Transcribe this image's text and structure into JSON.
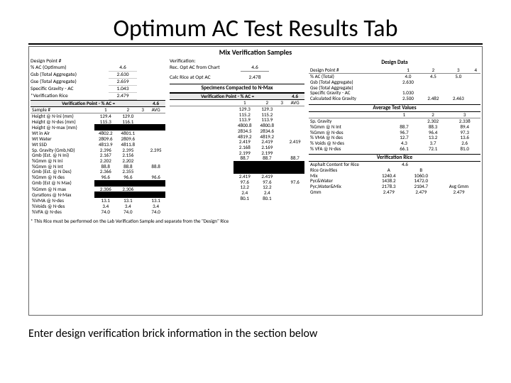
{
  "title": "Optimum AC Test Results Tab",
  "sheet": {
    "heading": "Mix Verification Samples",
    "left": {
      "designPoint": "Design Point #",
      "pctACopt": "% AC (Optimum)",
      "gsbTotal": "Gsb (Total Aggregate)",
      "gseTotal": "Gse (Total Aggregate)",
      "specGravAC": "Specific Gravity - AC",
      "verifRice": "*Verification Rice",
      "vals": {
        "pctAC": "4.6",
        "gsb": "2.630",
        "gse": "2.659",
        "sg": "1.043",
        "rice": "2.479"
      },
      "verifHdr": "Verification Point - % AC =",
      "verifAC": "4.6",
      "sampleHdr": "Sample #",
      "rows": {
        "htNini": "Height @ N-ini (mm)",
        "htNdes": "Height @ N-des (mm)",
        "htNmax": "Height @ N-max (mm)",
        "wtAir": "Wt in Air",
        "wtWater": "Wt Water",
        "wtSSD": "Wt SSD",
        "spGrav": "Sp. Gravity (Gmb,ND)",
        "gmbNini": "Gmb (Est. @ N Ini)",
        "pctGmmNini": "%Gmm @ N Ini",
        "pctGmmNint": "%Gmm @ N Int",
        "gmbNdes": "Gmb (Est. @ N Des)",
        "pctGmmNdes": "%Gmm @ N des",
        "gmbNmax": "Gmb (Est @ N Max)",
        "pctGmmNmax": "%Gmm @ N max",
        "gyrNmax": "Gyrations @ N-Max",
        "pctVMA": "%VMA @ N-des",
        "pctVoids": "%Voids @ N-des",
        "pctVFA": "%VFA @ N-des"
      },
      "data": {
        "htNini": [
          "129.4",
          "129.0",
          "",
          "",
          ""
        ],
        "htNdes": [
          "115.3",
          "116.1",
          "",
          "",
          ""
        ],
        "wtAir": [
          "4802.2",
          "4801.1",
          "",
          "",
          ""
        ],
        "wtWater": [
          "2809.6",
          "2809.6",
          "",
          "",
          ""
        ],
        "wtSSD": [
          "4813.9",
          "4811.8",
          "",
          "",
          ""
        ],
        "spGrav": [
          "2.396",
          "2.395",
          "",
          "",
          "2.395"
        ],
        "gmbNini": [
          "2.167",
          "2.156",
          "",
          "",
          ""
        ],
        "pctGmmNini": [
          "2.202",
          "2.202",
          "",
          "",
          ""
        ],
        "pctGmmNint": [
          "88.8",
          "88.8",
          "",
          "",
          "88.8"
        ],
        "gmbNdes": [
          "2.366",
          "2.355",
          "",
          "",
          ""
        ],
        "pctGmmNdes": [
          "96.6",
          "96.6",
          "",
          "",
          "96.6"
        ],
        "gmbNmax": [
          "2.306",
          "2.306",
          "",
          "",
          ""
        ],
        "pctVMA": [
          "13.1",
          "13.1",
          "",
          "",
          "13.1"
        ],
        "pctVoids": [
          "3.4",
          "3.4",
          "",
          "",
          "3.4"
        ],
        "pctVFA": [
          "74.0",
          "74.0",
          "",
          "",
          "74.0"
        ]
      }
    },
    "mid": {
      "verification": "Verification:",
      "recOptLabel": "Rec. Opt AC from Chart",
      "recOpt": "4.6",
      "calcRiceLbl": "Calc Rice at Opt AC",
      "calcRice": "2.478",
      "specHead": "Specimens Compacted to N-Max",
      "verifHdr": "Verification Point - % AC =",
      "verifAC": "4.6",
      "data": {
        "htNini": [
          "129.3",
          "129.3",
          "",
          "",
          ""
        ],
        "htNdes": [
          "115.2",
          "115.2",
          "",
          "",
          ""
        ],
        "htNmax": [
          "113.9",
          "113.9",
          "",
          "",
          ""
        ],
        "wtAir": [
          "4800.8",
          "4800.8",
          "",
          "",
          ""
        ],
        "wtWater": [
          "2834.5",
          "2834.6",
          "",
          "",
          ""
        ],
        "wtSSD": [
          "4819.2",
          "4819.2",
          "",
          "",
          ""
        ],
        "spGrav": [
          "2.419",
          "2.419",
          "",
          "",
          "2.419"
        ],
        "gmbNini": [
          "2.168",
          "2.169",
          "",
          "",
          ""
        ],
        "pctGmmNini": [
          "2.199",
          "2.199",
          "",
          "",
          ""
        ],
        "pctGmmNint": [
          "88.7",
          "88.7",
          "",
          "",
          "88.7"
        ],
        "gmbNmax": [
          "2.419",
          "2.419",
          "",
          "",
          ""
        ],
        "pctGmmNmax": [
          "97.6",
          "97.6",
          "",
          "",
          "97.6"
        ],
        "pctVMA": [
          "12.2",
          "12.2",
          "",
          "",
          ""
        ],
        "pctVoids": [
          "2.4",
          "2.4",
          "",
          "",
          ""
        ],
        "pctVFA": [
          "80.1",
          "80.1",
          "",
          "",
          ""
        ]
      }
    },
    "right": {
      "designDataTitle": "Design Data",
      "designHead": {
        "pt": "Design Point #",
        "c1": "1",
        "c2": "2",
        "c3": "3",
        "c4": "4"
      },
      "rows": {
        "pctAC": "% AC (Total)",
        "gsb": "Gsb (Total Aggregate)",
        "gse": "Gse (Total Aggregate)",
        "sg": "Specific Gravity - AC",
        "calcRice": "Calculated Rice Gravity"
      },
      "vals": {
        "pctAC": [
          "4.0",
          "4.5",
          "5.0",
          ""
        ],
        "gsb": [
          "2.630",
          "",
          "",
          ""
        ],
        "gse": [
          "",
          "",
          "",
          ""
        ],
        "sg": [
          "1.030",
          "",
          "",
          ""
        ],
        "calcRice": [
          "2.500",
          "2.482",
          "2.463",
          ""
        ]
      },
      "avgTitle": "Average Test Values",
      "avgRows": {
        "spGrav": "Sp. Gravity",
        "pctGmmNint": "%Gmm @ N Int",
        "pctGmmNdes": "%Gmm @ N-des",
        "pctVMA": "% VMA @ N des",
        "pctVoids": "% Voids @ N-des",
        "pctVFA": "% VFA @ N-des"
      },
      "avgCols": [
        "1",
        "2",
        "3"
      ],
      "avgVals": {
        "spGrav": [
          "",
          "2.302",
          "2.338"
        ],
        "pctGmmNint": [
          "88.7",
          "88.3",
          "89.4"
        ],
        "pctGmmNdes": [
          "96.7",
          "96.4",
          "97.3"
        ],
        "pctVMA": [
          "12.7",
          "13.2",
          "13.6"
        ],
        "pctVoids": [
          "4.3",
          "3.7",
          "2.6"
        ],
        "pctVFA": [
          "66.1",
          "72.1",
          "81.0"
        ]
      },
      "vrTitle": "Verification Rice",
      "asphContent": "Asphalt Content for Rice",
      "asphVal": "4.6",
      "riceGrav": "Rice Gravities",
      "colA": "A",
      "colB": "B",
      "mix": "Mix",
      "mixA": "1240.4",
      "mixB": "1060.0",
      "pycW": "Pyc&Water",
      "pycWA": "1438.2",
      "pycWB": "1472.0",
      "pycWM": "Pyc,Water&Mix",
      "pycWMA": "2178.3",
      "pycWMB": "2104.7",
      "gmm": "Gmm",
      "gmmA": "2.479",
      "gmmB": "2.479",
      "gmmAvg": "2.479",
      "avgGmmLbl": "Avg Gmm"
    },
    "note": "* This Rice must be performed on the Lab Verification Sample and separate from the \"Design\" Rice"
  },
  "footer": "Enter design verification brick information in the section below"
}
